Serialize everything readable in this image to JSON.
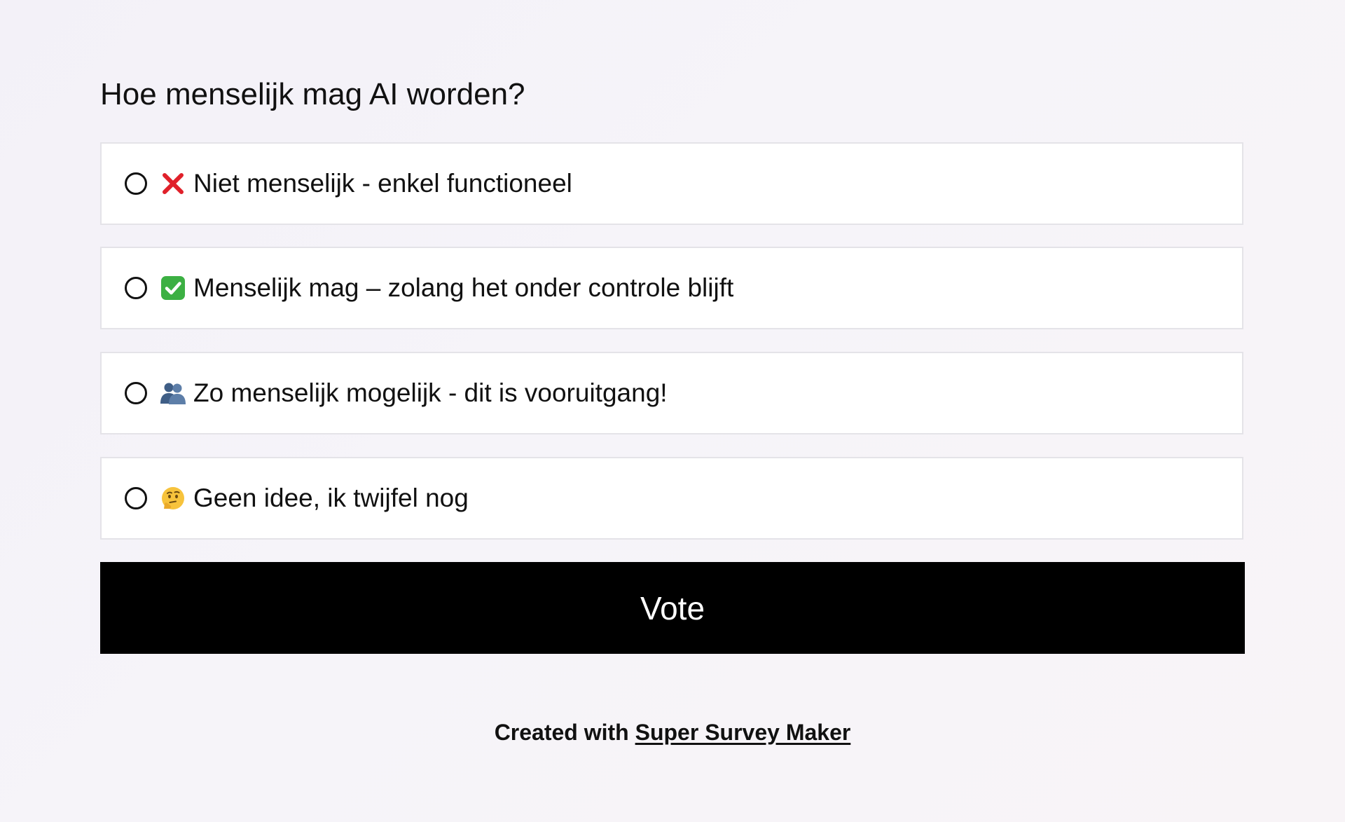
{
  "poll": {
    "question": "Hoe menselijk mag AI worden?",
    "options": [
      {
        "emoji": "cross-mark-icon",
        "label": "Niet menselijk - enkel functioneel"
      },
      {
        "emoji": "check-mark-button-icon",
        "label": "Menselijk mag – zolang het onder controle blijft"
      },
      {
        "emoji": "people-silhouette-icon",
        "label": "Zo menselijk mogelijk - dit is vooruitgang!"
      },
      {
        "emoji": "thinking-face-icon",
        "label": "Geen idee, ik twijfel nog"
      }
    ],
    "vote_label": "Vote"
  },
  "footer": {
    "prefix": "Created with",
    "link_text": "Super Survey Maker"
  },
  "colors": {
    "button_bg": "#000000",
    "button_text": "#ffffff",
    "option_border": "#e4e3e8",
    "cross_red": "#e0202a",
    "check_green": "#3cb043"
  }
}
